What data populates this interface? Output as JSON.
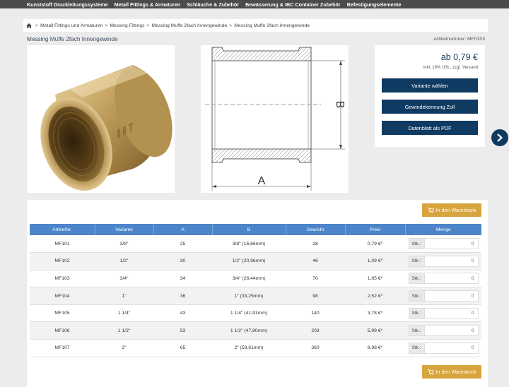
{
  "nav": {
    "items": [
      "Kunststoff Druckleitungssysteme",
      "Metall Fittings & Armaturen",
      "Schläuche & Zubehör",
      "Bewässerung & IBC Container Zubehör",
      "Befestigungselemente"
    ]
  },
  "breadcrumb": {
    "items": [
      "Metall Fittings und Armaturen",
      "Messing Fittings",
      "Messing Muffe 2fach Innengewinde",
      "Messing Muffe 2fach Innengewinde"
    ],
    "separator": ">"
  },
  "product": {
    "title": "Messing Muffe 2fach Innengewinde",
    "article_number": "Artikelnummer: MF0103",
    "price": "ab 0,79 €",
    "price_note": "inkl. 19% USt., zzgl. Versand",
    "drawing_label_a": "A",
    "drawing_label_b": "B"
  },
  "buttons": {
    "variant": "Variante wählen",
    "customs": "Gewindekennung Zoll",
    "datasheet": "Datenblatt als PDF",
    "cart": "In den Warenkorb"
  },
  "table": {
    "headers": [
      "ArtikelNr.",
      "Variante",
      "A",
      "B",
      "Gewicht",
      "Preis",
      "Menge"
    ],
    "qty_label": "Stk.:",
    "rows": [
      {
        "nr": "MF101",
        "variante": "3/8\"",
        "a": "25",
        "b": "3/8\" (16,66mm)",
        "gewicht": "28",
        "preis": "0,79 €*",
        "menge": "0"
      },
      {
        "nr": "MF102",
        "variante": "1/2\"",
        "a": "30",
        "b": "1/2\" (20,96mm)",
        "gewicht": "46",
        "preis": "1,09 €*",
        "menge": "0"
      },
      {
        "nr": "MF103",
        "variante": "3/4\"",
        "a": "34",
        "b": "3/4\" (26,44mm)",
        "gewicht": "70",
        "preis": "1,65 €*",
        "menge": "0"
      },
      {
        "nr": "MF104",
        "variante": "1\"",
        "a": "36",
        "b": "1\" (33,25mm)",
        "gewicht": "98",
        "preis": "2,52 €*",
        "menge": "0"
      },
      {
        "nr": "MF105",
        "variante": "1 1/4\"",
        "a": "43",
        "b": "1 1/4\" (41,91mm)",
        "gewicht": "140",
        "preis": "3,78 €*",
        "menge": "0"
      },
      {
        "nr": "MF106",
        "variante": "1 1/2\"",
        "a": "53",
        "b": "1 1/2\" (47,80mm)",
        "gewicht": "203",
        "preis": "5,99 €*",
        "menge": "0"
      },
      {
        "nr": "MF107",
        "variante": "2\"",
        "a": "65",
        "b": "2\" (59,61mm)",
        "gewicht": "360",
        "preis": "8,98 €*",
        "menge": "0"
      }
    ]
  },
  "colors": {
    "nav_bg": "#4b4b4b",
    "primary": "#0f3a62",
    "table_header": "#4c85c9",
    "cart": "#d7a43d"
  },
  "icons": {
    "home": "home-icon",
    "cart": "cart-icon",
    "next": "chevron-right-icon"
  }
}
